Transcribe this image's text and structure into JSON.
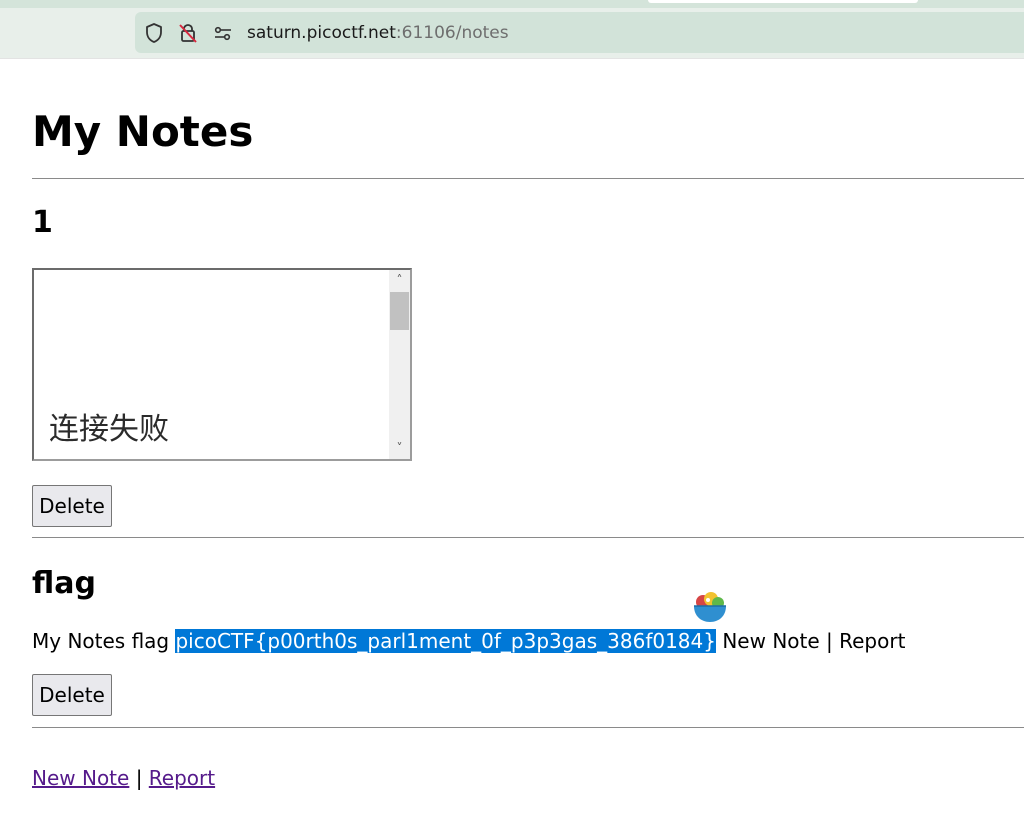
{
  "browser": {
    "url_host": "saturn.picoctf.net",
    "url_rest": ":61106/notes",
    "icons": [
      "shield-icon",
      "tracking-off-icon",
      "site-settings-icon"
    ]
  },
  "page": {
    "title": "My Notes"
  },
  "notes": [
    {
      "title": "1",
      "frame_text": "连接失败",
      "delete_label": "Delete"
    },
    {
      "title": "flag",
      "body_prefix": "My Notes flag ",
      "body_selected": "picoCTF{p00rth0s_parl1ment_0f_p3p3gas_386f0184}",
      "body_suffix": " New Note | Report",
      "delete_label": "Delete"
    }
  ],
  "footer": {
    "new_note_label": "New Note",
    "separator": "|",
    "report_label": "Report"
  },
  "colors": {
    "selection": "#0078d7",
    "visited_link": "#551a8b"
  }
}
